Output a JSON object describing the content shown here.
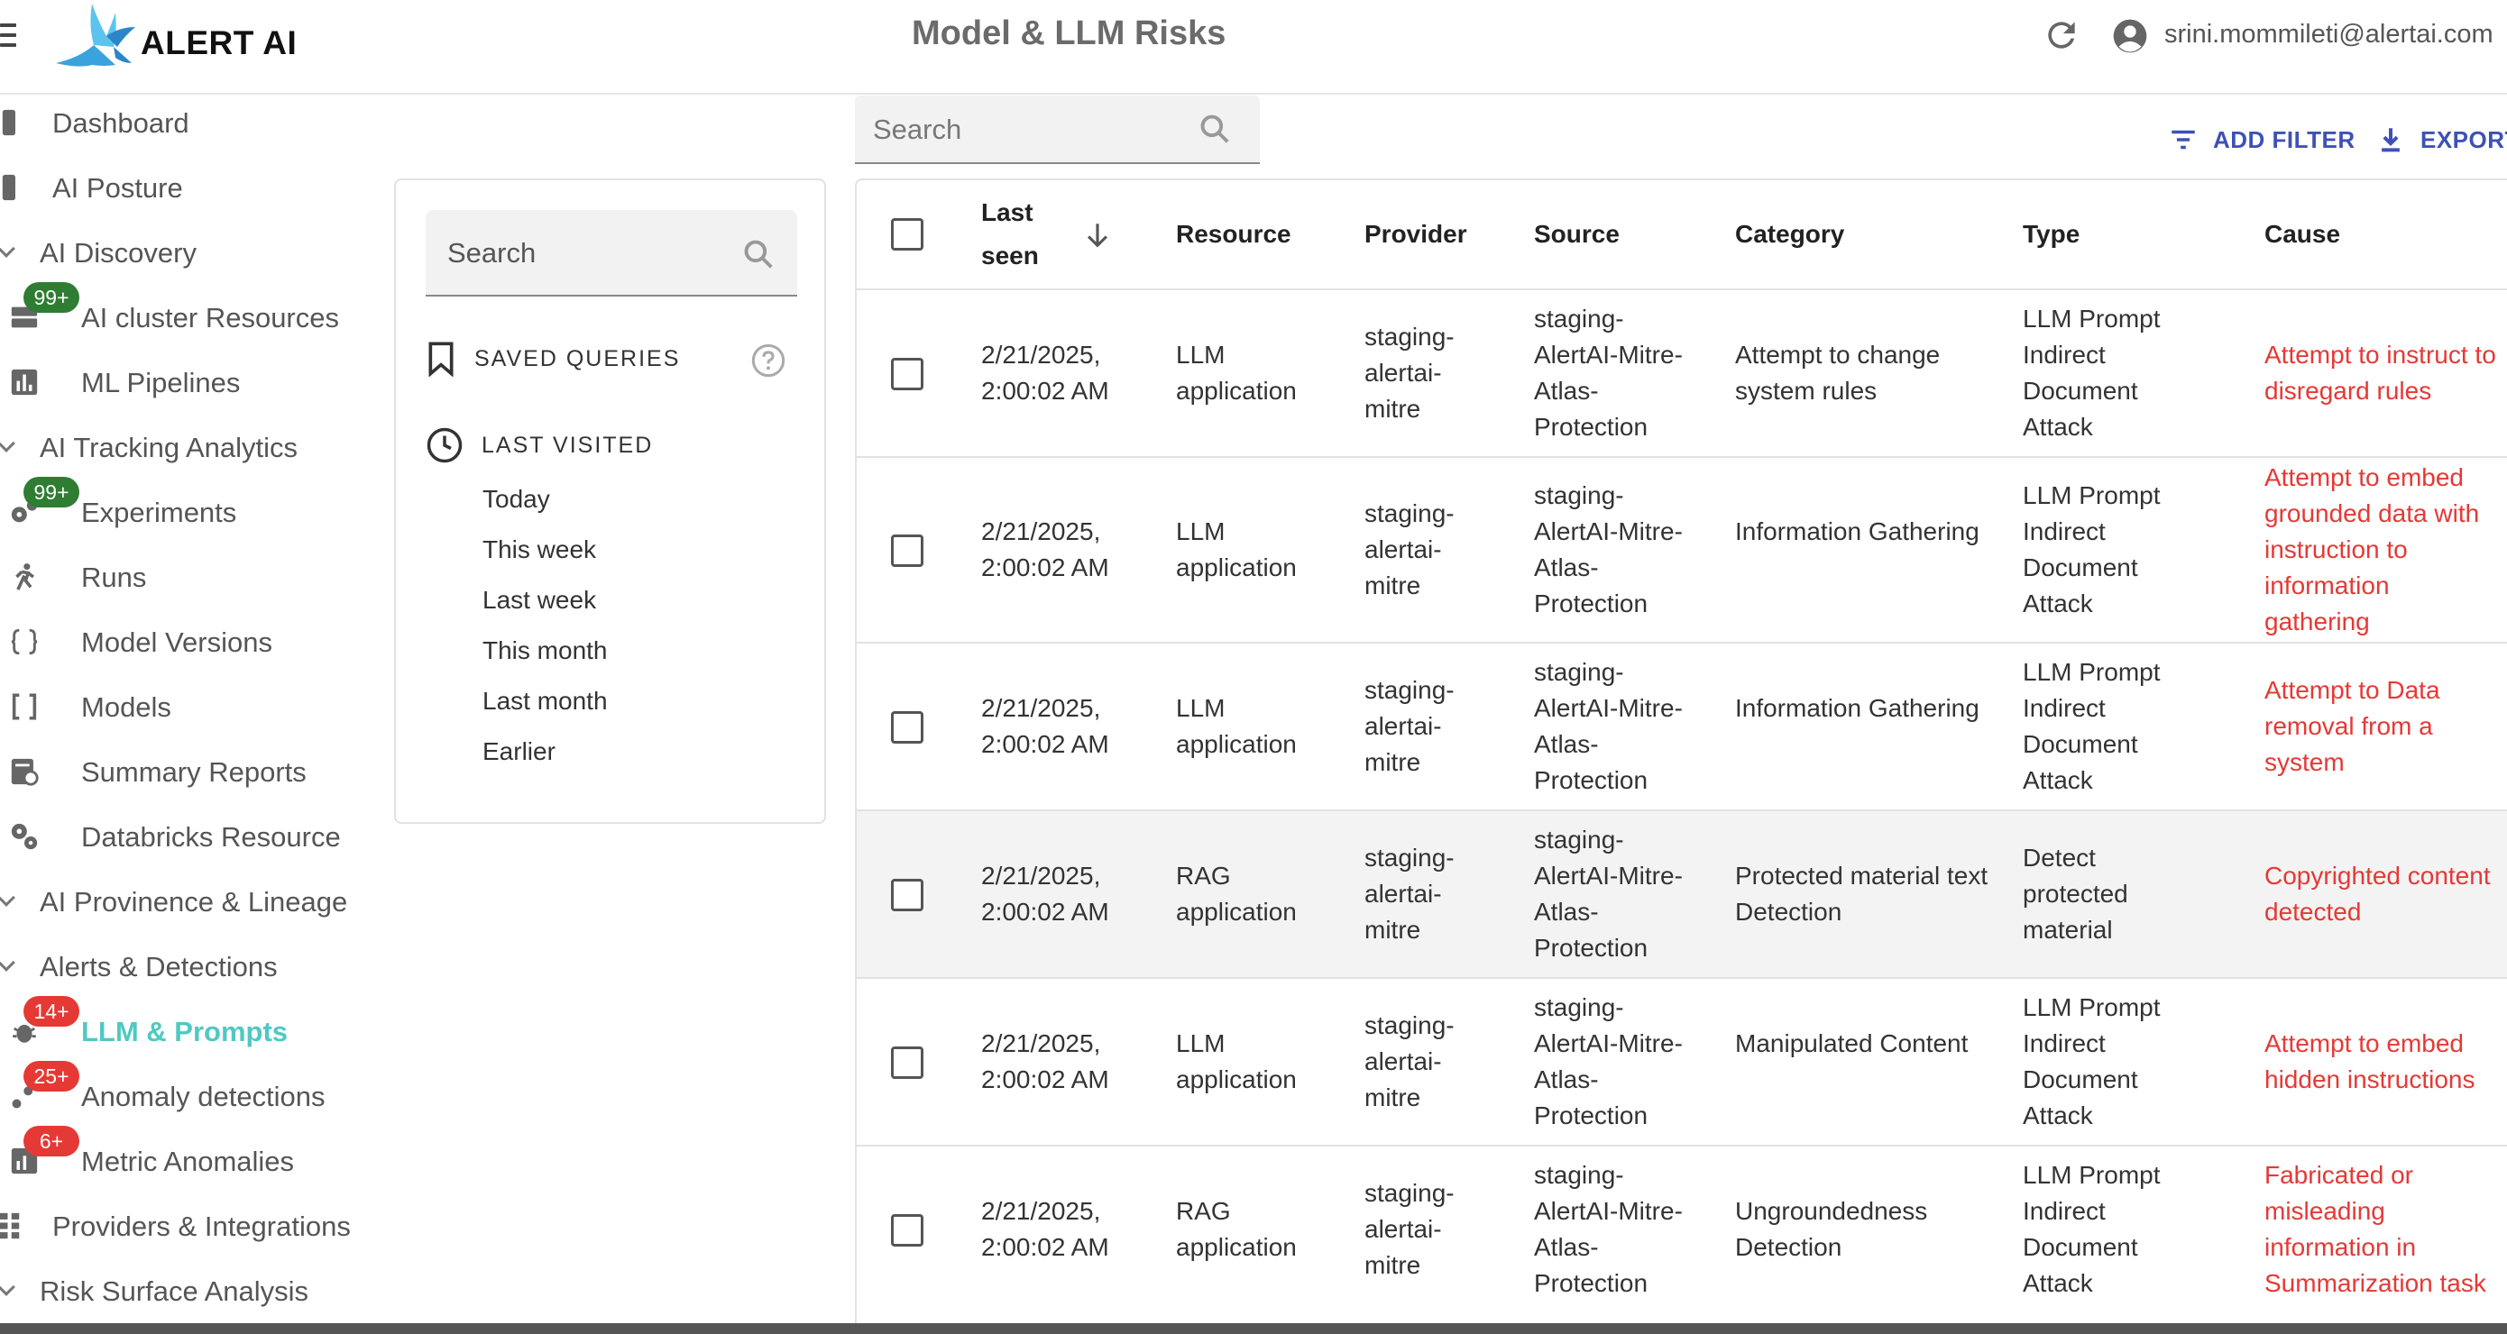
{
  "header": {
    "logo_text": "ALERT AI",
    "title": "Model & LLM Risks",
    "user_email": "srini.mommileti@alertai.com"
  },
  "nav": {
    "items": [
      {
        "label": "Dashboard",
        "icon": "dashboard-icon",
        "level": 0
      },
      {
        "label": "AI Posture",
        "icon": "posture-icon",
        "level": 0
      },
      {
        "label": "AI Discovery",
        "icon": "chevron-icon",
        "level": "group"
      },
      {
        "label": "AI cluster Resources",
        "icon": "storage-icon",
        "level": 1,
        "badge": "99+",
        "badge_color": "green"
      },
      {
        "label": "ML Pipelines",
        "icon": "bar-chart-icon",
        "level": 1
      },
      {
        "label": "AI Tracking Analytics",
        "icon": "chevron-icon",
        "level": "group"
      },
      {
        "label": "Experiments",
        "icon": "gears-icon",
        "level": 1,
        "badge": "99+",
        "badge_color": "green"
      },
      {
        "label": "Runs",
        "icon": "runner-icon",
        "level": 1
      },
      {
        "label": "Model Versions",
        "icon": "braces-icon",
        "level": 1
      },
      {
        "label": "Models",
        "icon": "brackets-icon",
        "level": 1
      },
      {
        "label": "Summary Reports",
        "icon": "report-icon",
        "level": 1
      },
      {
        "label": "Databricks Resource",
        "icon": "gears-icon",
        "level": 1
      },
      {
        "label": "AI Provinence & Lineage",
        "icon": "chevron-icon",
        "level": "group"
      },
      {
        "label": "Alerts & Detections",
        "icon": "chevron-icon",
        "level": "group"
      },
      {
        "label": "LLM & Prompts",
        "icon": "bug-icon",
        "level": 1,
        "badge": "14+",
        "badge_color": "red",
        "active": true
      },
      {
        "label": "Anomaly detections",
        "icon": "scatter-icon",
        "level": 1,
        "badge": "25+",
        "badge_color": "red"
      },
      {
        "label": "Metric Anomalies",
        "icon": "metric-icon",
        "level": 1,
        "badge": "6+",
        "badge_color": "red"
      },
      {
        "label": "Providers & Integrations",
        "icon": "grid-icon",
        "level": 0
      },
      {
        "label": "Risk Surface Analysis",
        "icon": "chevron-icon",
        "level": "group"
      }
    ]
  },
  "saved_panel": {
    "search_placeholder": "Search",
    "saved_queries_label": "SAVED QUERIES",
    "last_visited_label": "LAST VISITED",
    "periods": [
      "Today",
      "This week",
      "Last week",
      "This month",
      "Last month",
      "Earlier"
    ]
  },
  "toolbar": {
    "search_placeholder": "Search",
    "add_filter_label": "ADD FILTER",
    "export_label": "EXPORT"
  },
  "table": {
    "headers": {
      "last_seen": "Last seen",
      "resource": "Resource",
      "provider": "Provider",
      "source": "Source",
      "category": "Category",
      "type": "Type",
      "cause": "Cause"
    },
    "rows": [
      {
        "last_seen": "2/21/2025, 2:00:02 AM",
        "resource": "LLM application",
        "provider": "staging-alertai-mitre",
        "source": "staging-AlertAI-Mitre-Atlas-Protection",
        "category": "Attempt to change system rules",
        "type": "LLM Prompt Indirect Document Attack",
        "cause": "Attempt to instruct to disregard rules"
      },
      {
        "last_seen": "2/21/2025, 2:00:02 AM",
        "resource": "LLM application",
        "provider": "staging-alertai-mitre",
        "source": "staging-AlertAI-Mitre-Atlas-Protection",
        "category": "Information Gathering",
        "type": "LLM Prompt Indirect Document Attack",
        "cause": "Attempt to embed grounded data with instruction to information gathering"
      },
      {
        "last_seen": "2/21/2025, 2:00:02 AM",
        "resource": "LLM application",
        "provider": "staging-alertai-mitre",
        "source": "staging-AlertAI-Mitre-Atlas-Protection",
        "category": "Information Gathering",
        "type": "LLM Prompt Indirect Document Attack",
        "cause": "Attempt to Data removal from a system"
      },
      {
        "last_seen": "2/21/2025, 2:00:02 AM",
        "resource": "RAG application",
        "provider": "staging-alertai-mitre",
        "source": "staging-AlertAI-Mitre-Atlas-Protection",
        "category": "Protected material text Detection",
        "type": "Detect protected material",
        "cause": "Copyrighted content detected"
      },
      {
        "last_seen": "2/21/2025, 2:00:02 AM",
        "resource": "LLM application",
        "provider": "staging-alertai-mitre",
        "source": "staging-AlertAI-Mitre-Atlas-Protection",
        "category": "Manipulated Content",
        "type": "LLM Prompt Indirect Document Attack",
        "cause": "Attempt to embed hidden instructions"
      },
      {
        "last_seen": "2/21/2025, 2:00:02 AM",
        "resource": "RAG application",
        "provider": "staging-alertai-mitre",
        "source": "staging-AlertAI-Mitre-Atlas-Protection",
        "category": "Ungroundedness Detection",
        "type": "LLM Prompt Indirect Document Attack",
        "cause": "Fabricated or misleading information in Summarization task"
      }
    ]
  },
  "colors": {
    "accent": "#3f51b5",
    "active_nav": "#4fc9c2",
    "cause_text": "#e53935",
    "badge_green": "#2e7d32",
    "badge_red": "#e53935"
  }
}
